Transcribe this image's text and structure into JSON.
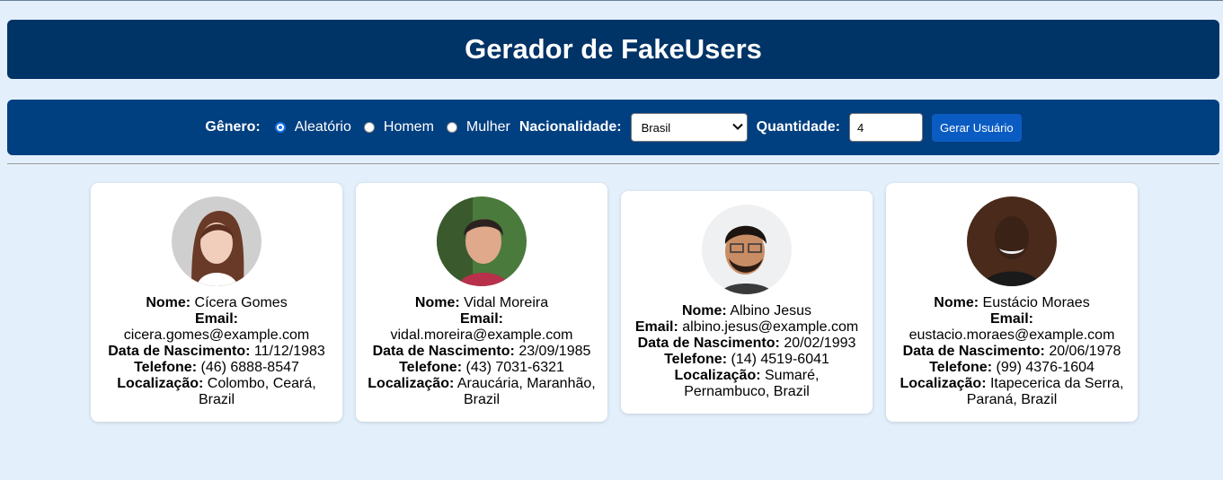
{
  "header": {
    "title": "Gerador de FakeUsers"
  },
  "controls": {
    "gender_label": "Gênero:",
    "gender_options": [
      "Aleatório",
      "Homem",
      "Mulher"
    ],
    "gender_selected": "Aleatório",
    "nationality_label": "Nacionalidade:",
    "nationality_value": "Brasil",
    "quantity_label": "Quantidade:",
    "quantity_value": "4",
    "generate_label": "Gerar Usuário"
  },
  "field_labels": {
    "name": "Nome:",
    "email": "Email:",
    "birth": "Data de Nascimento:",
    "phone": "Telefone:",
    "location": "Localização:"
  },
  "users": [
    {
      "name": "Cícera Gomes",
      "email": "cicera.gomes@example.com",
      "birth": "11/12/1983",
      "phone": "(46) 6888-8547",
      "location": "Colombo, Ceará, Brazil"
    },
    {
      "name": "Vidal Moreira",
      "email": "vidal.moreira@example.com",
      "birth": "23/09/1985",
      "phone": "(43) 7031-6321",
      "location": "Araucária, Maranhão, Brazil"
    },
    {
      "name": "Albino Jesus",
      "email": "albino.jesus@example.com",
      "birth": "20/02/1993",
      "phone": "(14) 4519-6041",
      "location": "Sumaré, Pernambuco, Brazil"
    },
    {
      "name": "Eustácio Moraes",
      "email": "eustacio.moraes@example.com",
      "birth": "20/06/1978",
      "phone": "(99) 4376-1604",
      "location": "Itapecerica da Serra, Paraná, Brazil"
    }
  ],
  "colors": {
    "page_bg": "#e3f0fc",
    "header_bg": "#003366",
    "controls_bg": "#003f80",
    "button_bg": "#0b5cc2"
  }
}
